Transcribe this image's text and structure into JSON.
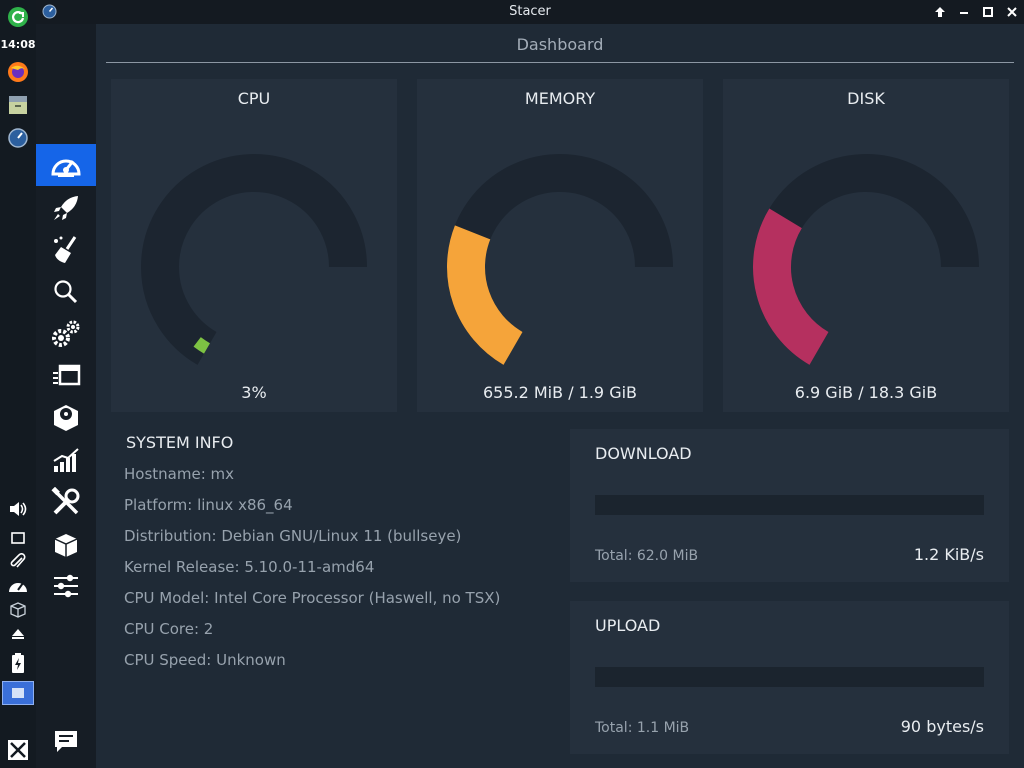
{
  "panel": {
    "clock": "14:08"
  },
  "window": {
    "title": "Stacer"
  },
  "main": {
    "page_title": "Dashboard"
  },
  "gauges": [
    {
      "title": "CPU",
      "value": "3%",
      "fraction": 0.03,
      "color": "#7dc243"
    },
    {
      "title": "MEMORY",
      "value": "655.2 MiB / 1.9 GiB",
      "fraction": 0.34,
      "color": "#f5a43a"
    },
    {
      "title": "DISK",
      "value": "6.9 GiB / 18.3 GiB",
      "fraction": 0.38,
      "color": "#b5305f"
    }
  ],
  "system_info": {
    "title": "SYSTEM INFO",
    "lines": [
      "Hostname: mx",
      "Platform: linux x86_64",
      "Distribution: Debian GNU/Linux 11 (bullseye)",
      "Kernel Release: 5.10.0-11-amd64",
      "CPU Model:  Intel Core Processor (Haswell, no TSX)",
      "CPU Core: 2",
      "CPU Speed: Unknown"
    ]
  },
  "network": {
    "download": {
      "title": "DOWNLOAD",
      "total": "Total: 62.0 MiB",
      "speed": "1.2 KiB/s"
    },
    "upload": {
      "title": "UPLOAD",
      "total": "Total: 1.1 MiB",
      "speed": "90 bytes/s"
    }
  },
  "colors": {
    "accent": "#1565e8",
    "track": "#1c2530"
  }
}
